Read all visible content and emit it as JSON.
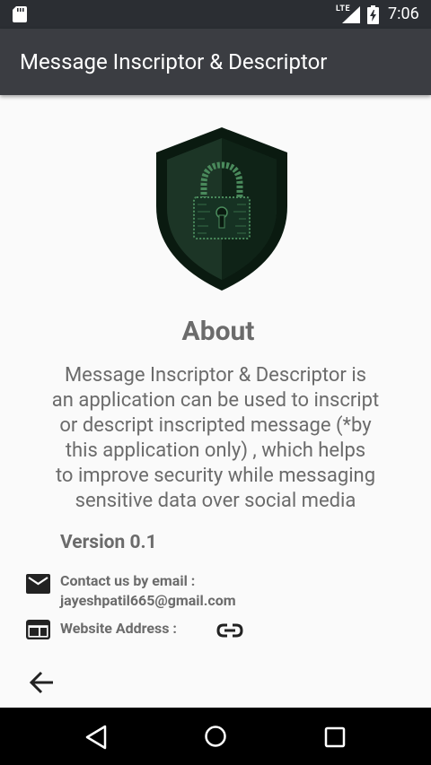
{
  "status_bar": {
    "time": "7:06",
    "network": "LTE",
    "icons": [
      "sd-card-icon",
      "lte-signal-icon",
      "battery-charging-icon"
    ]
  },
  "app_bar": {
    "title": "Message Inscriptor & Descriptor"
  },
  "logo": {
    "icon": "shield-lock-icon",
    "colors": {
      "outer": "#0a1a10",
      "inner": "#1c3526",
      "circuit": "#4a8a5c"
    }
  },
  "about": {
    "heading": "About",
    "description_lines": [
      "Message Inscriptor & Descriptor is",
      "an application can be used to inscript",
      "or descript inscripted message (*by",
      "this application only) , which helps",
      "to improve security while messaging",
      "sensitive data over social media"
    ],
    "version": "Version 0.1"
  },
  "contact": {
    "icon": "mail-icon",
    "label": "Contact us by email :",
    "email": "jayeshpatil665@gmail.com"
  },
  "website": {
    "icon": "web-icon",
    "label": "Website Address :",
    "link_icon": "link-icon"
  },
  "navigation": {
    "back_icon": "back-arrow-icon",
    "system": [
      "nav-back-icon",
      "nav-home-icon",
      "nav-recents-icon"
    ]
  },
  "colors": {
    "status_bar": "#2b2e33",
    "app_bar": "#3b3d42",
    "background": "#fafafa",
    "text": "#6b6b6b",
    "nav_bar": "#000000"
  }
}
